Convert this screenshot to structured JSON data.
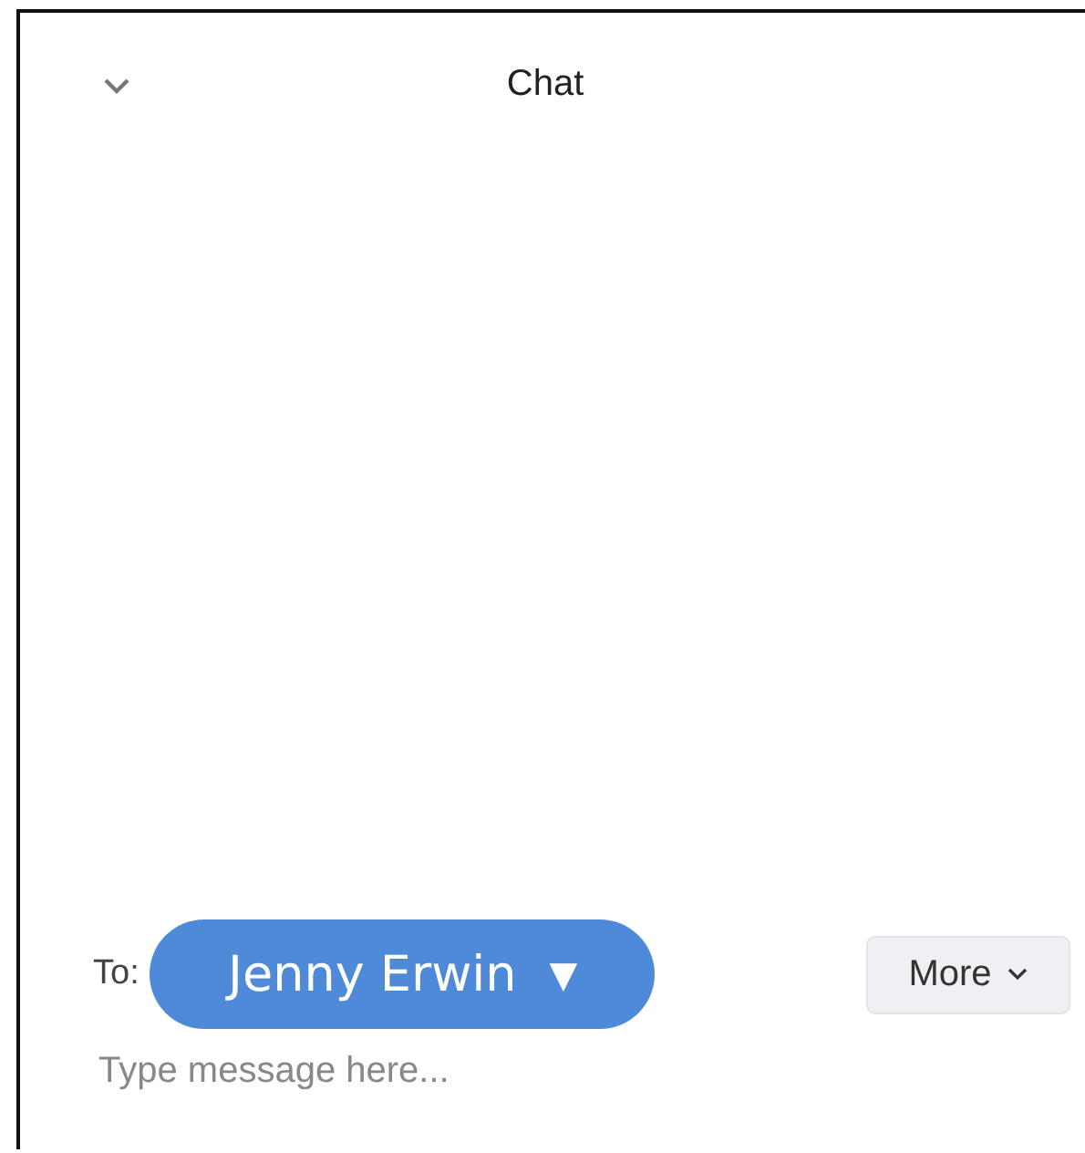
{
  "header": {
    "title": "Chat"
  },
  "recipient": {
    "label": "To:",
    "name": "Jenny Erwin",
    "caret": "▼"
  },
  "more_button": {
    "label": "More"
  },
  "message": {
    "placeholder": "Type message here..."
  }
}
